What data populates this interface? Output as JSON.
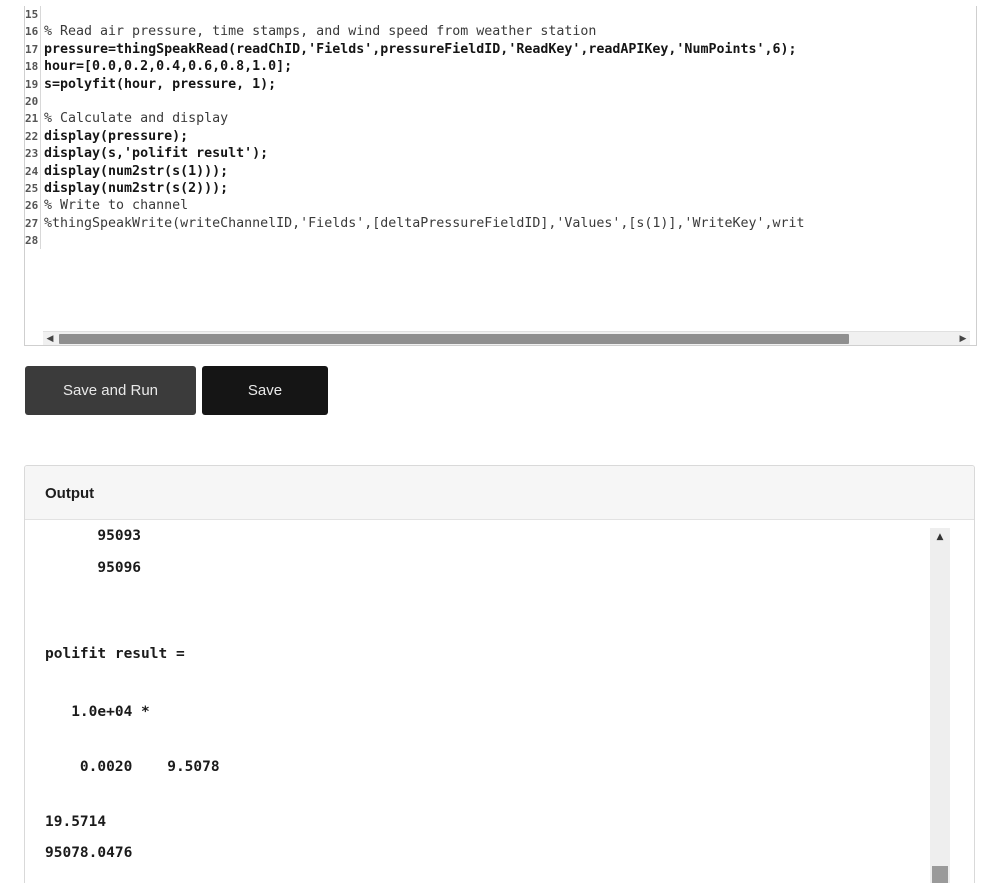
{
  "editor": {
    "lines": [
      {
        "num": "15",
        "text": ""
      },
      {
        "num": "16",
        "text": "% Read air pressure, time stamps, and wind speed from weather station"
      },
      {
        "num": "17",
        "text": "pressure=thingSpeakRead(readChID,'Fields',pressureFieldID,'ReadKey',readAPIKey,'NumPoints',6);"
      },
      {
        "num": "18",
        "text": "hour=[0.0,0.2,0.4,0.6,0.8,1.0];"
      },
      {
        "num": "19",
        "text": "s=polyfit(hour, pressure, 1);"
      },
      {
        "num": "20",
        "text": ""
      },
      {
        "num": "21",
        "text": "% Calculate and display"
      },
      {
        "num": "22",
        "text": "display(pressure);"
      },
      {
        "num": "23",
        "text": "display(s,'polifit result');"
      },
      {
        "num": "24",
        "text": "display(num2str(s(1)));"
      },
      {
        "num": "25",
        "text": "display(num2str(s(2)));"
      },
      {
        "num": "26",
        "text": "% Write to channel"
      },
      {
        "num": "27",
        "text": "%thingSpeakWrite(writeChannelID,'Fields',[deltaPressureFieldID],'Values',[s(1)],'WriteKey',writ"
      },
      {
        "num": "28",
        "text": ""
      }
    ],
    "scroll_left_glyph": "◀",
    "scroll_right_glyph": "▶"
  },
  "buttons": {
    "save_and_run": "Save and Run",
    "save": "Save"
  },
  "output": {
    "title": "Output",
    "lines": [
      "      95093",
      "      95096",
      "polifit result =",
      "   1.0e+04 *",
      "    0.0020    9.5078",
      "19.5714",
      "95078.0476"
    ],
    "scroll_up_glyph": "▲"
  }
}
